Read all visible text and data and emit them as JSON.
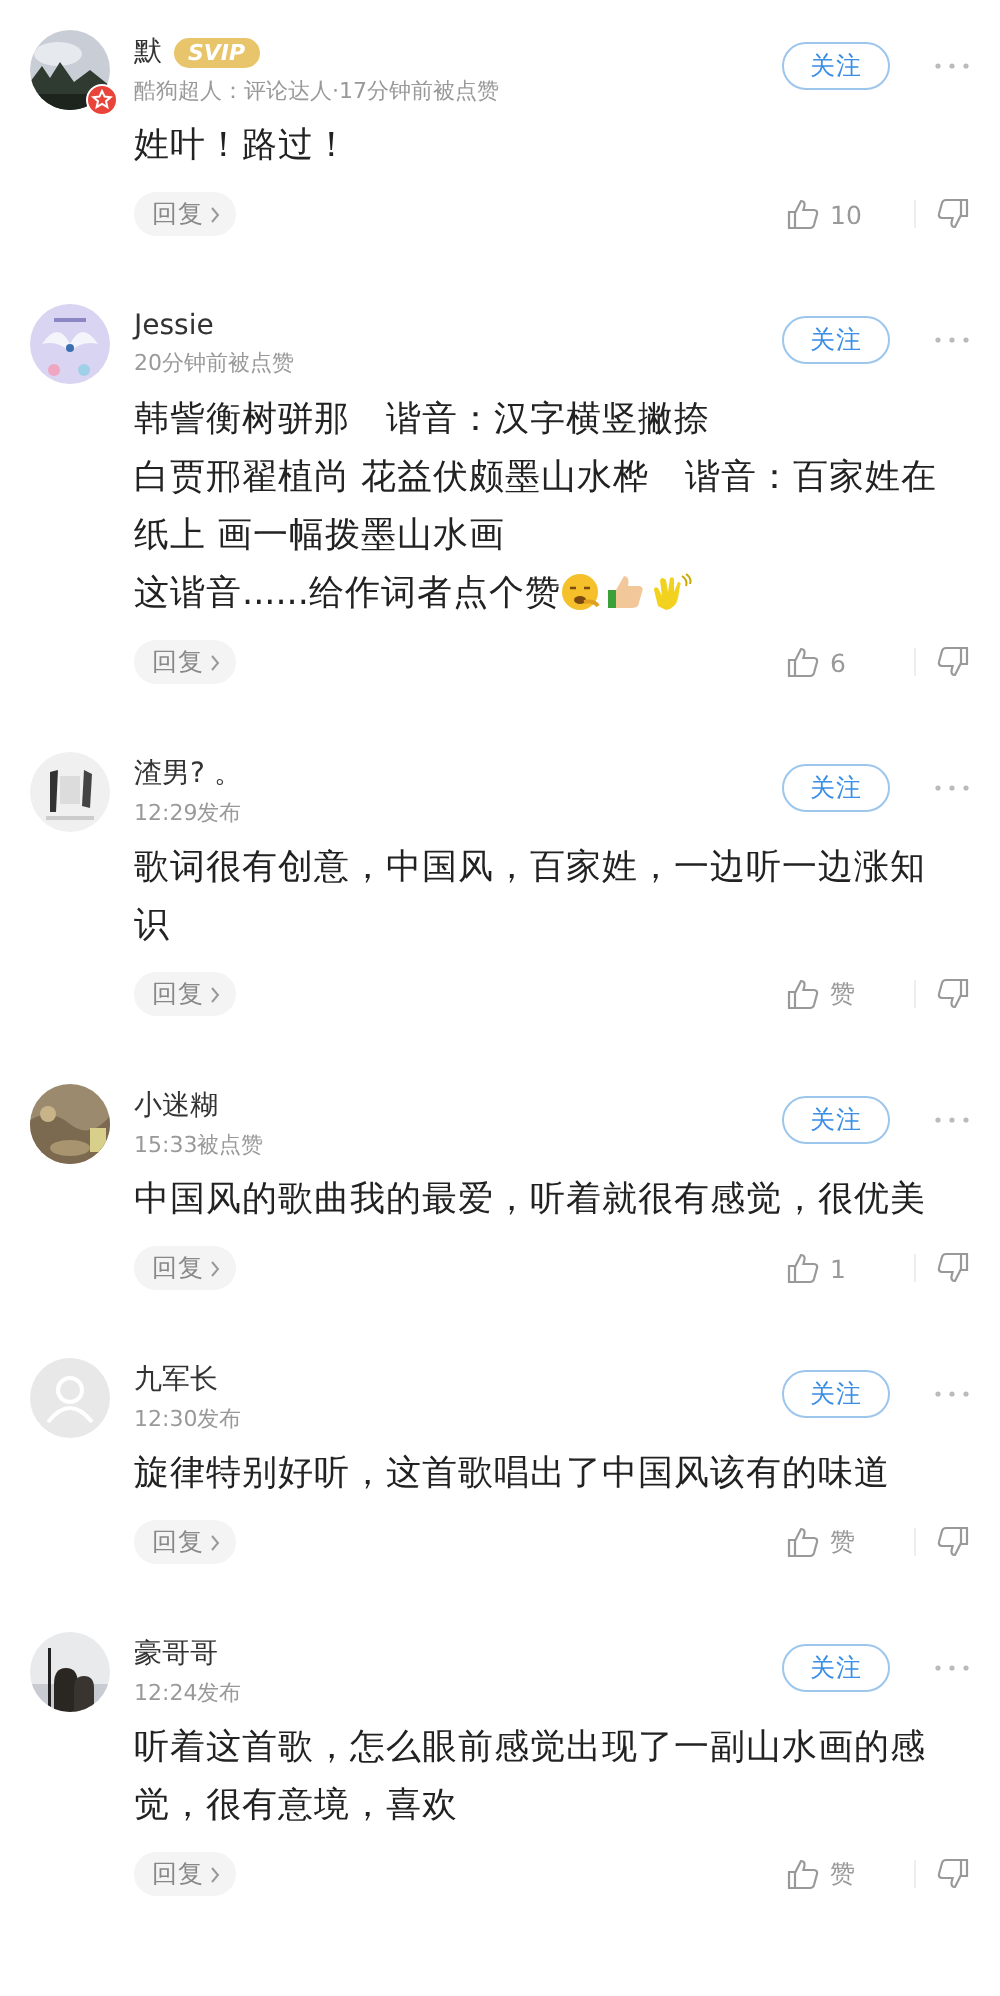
{
  "comments": [
    {
      "user": "默",
      "vip_badge": "SVIP",
      "avatar_badge": true,
      "meta": "酷狗超人：评论达人·17分钟前被点赞",
      "follow": "关注",
      "lines": [
        "姓叶！路过！"
      ],
      "reply": "回复",
      "likes": "10"
    },
    {
      "user": "Jessie",
      "avatar_badge": false,
      "meta": "20分钟前被点赞",
      "follow": "关注",
      "lines": [
        "韩訾衡树骈那　谐音：汉字横竖撇捺",
        "白贾邢翟植尚 花益伏颇墨山水桦　谐音：百家姓在纸上 画一幅拨墨山水画",
        "这谐音......给作词者点个赞"
      ],
      "stickers": [
        {
          "kind": "face"
        },
        {
          "kind": "thumb"
        },
        {
          "kind": "hand"
        }
      ],
      "reply": "回复",
      "likes": "6"
    },
    {
      "user": "渣男? 。",
      "avatar_badge": false,
      "meta": "12:29发布",
      "follow": "关注",
      "lines": [
        "歌词很有创意，中国风，百家姓，一边听一边涨知识"
      ],
      "reply": "回复",
      "likes": "赞"
    },
    {
      "user": "小迷糊",
      "avatar_badge": false,
      "meta": "15:33被点赞",
      "follow": "关注",
      "lines": [
        "中国风的歌曲我的最爱，听着就很有感觉，很优美"
      ],
      "reply": "回复",
      "likes": "1"
    },
    {
      "user": "九军长",
      "avatar": {
        "kind": "silhouette"
      },
      "avatar_badge": false,
      "meta": "12:30发布",
      "follow": "关注",
      "lines": [
        "旋律特别好听，这首歌唱出了中国风该有的味道"
      ],
      "reply": "回复",
      "likes": "赞"
    },
    {
      "user": "豪哥哥",
      "avatar_badge": false,
      "meta": "12:24发布",
      "follow": "关注",
      "lines": [
        "听着这首歌，怎么眼前感觉出现了一副山水画的感觉，很有意境，喜欢"
      ],
      "reply": "回复",
      "likes": "赞"
    }
  ]
}
